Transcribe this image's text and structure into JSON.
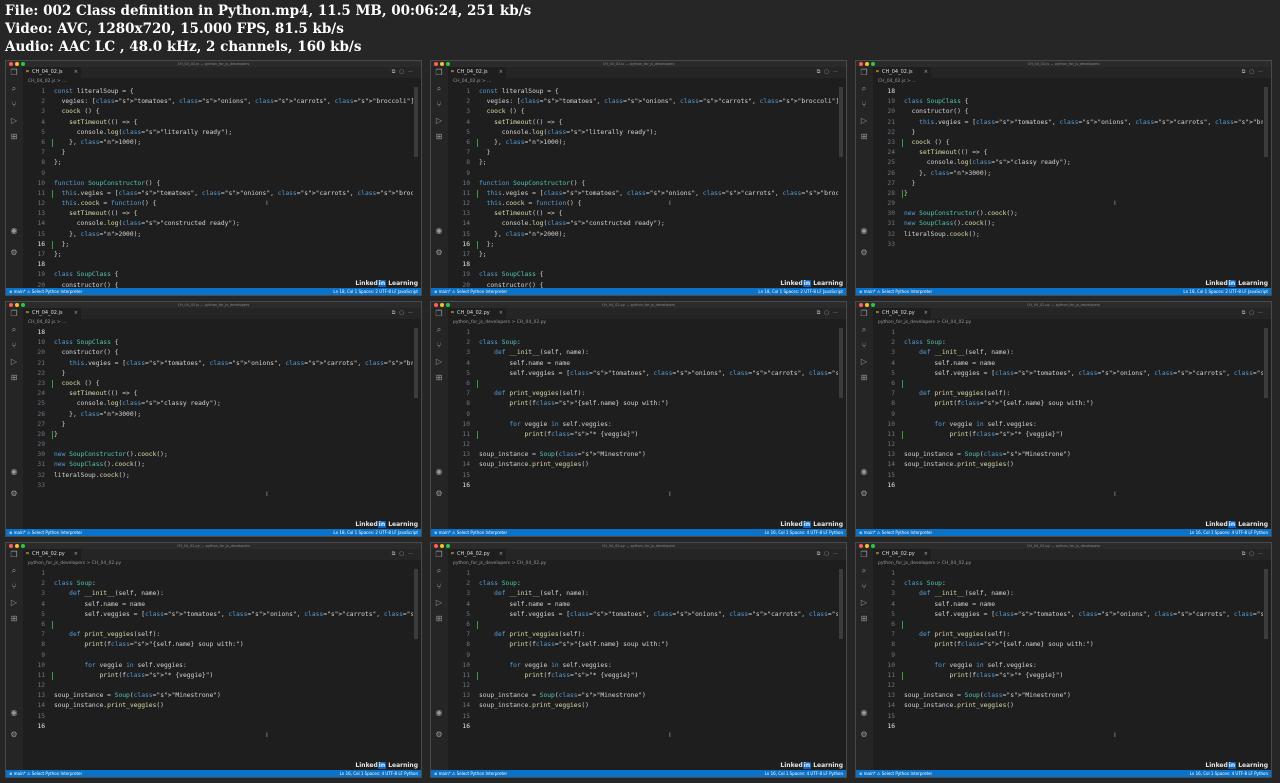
{
  "meta": {
    "line1": "File: 002 Class definition in Python.mp4, 11.5 MB, 00:06:24, 251 kb/s",
    "line2": "Video: AVC, 1280x720, 15.000 FPS, 81.5 kb/s",
    "line3": "Audio: AAC LC , 48.0 kHz, 2 channels, 160 kb/s"
  },
  "colors": {
    "statusbar": "#0b72c9",
    "editor_bg": "#1e1e1e",
    "page_bg": "#262626"
  },
  "icons": [
    "files-icon",
    "search-icon",
    "source-control-icon",
    "run-debug-icon",
    "extensions-icon",
    "account-icon",
    "settings-gear-icon"
  ],
  "frames": [
    {
      "title": "CH_04_02.js — python_for_js_developers",
      "tab": "CH_04_02.js",
      "breadcrumb": "CH_04_02.js > ...",
      "status_left": "⊗ main*   ⚠ Select Python Interpreter",
      "status_right": "Ln 18, Col 1   Spaces: 2   UTF-8   LF   JavaScript",
      "lines": [
        {
          "n": "1",
          "t": "const literalSoup = {"
        },
        {
          "n": "2",
          "t": "  vegies: [\"tomatoes\", \"onions\", \"carrots\", \"broccoli\"],"
        },
        {
          "n": "3",
          "t": "  coock () {"
        },
        {
          "n": "4",
          "t": "    setTimeout(() => {"
        },
        {
          "n": "5",
          "t": "      console.log(\"literally ready\");"
        },
        {
          "n": "6",
          "t": "    }, 1000);"
        },
        {
          "n": "7",
          "t": "  }"
        },
        {
          "n": "8",
          "t": "};"
        },
        {
          "n": "9",
          "t": ""
        },
        {
          "n": "10",
          "t": "function SoupConstructor() {"
        },
        {
          "n": "11",
          "t": "  this.vegies = [\"tomatoes\", \"onions\", \"carrots\", \"broccoli\"];"
        },
        {
          "n": "12",
          "t": "  this.coock = function() {"
        },
        {
          "n": "13",
          "t": "    setTimeout(() => {"
        },
        {
          "n": "14",
          "t": "      console.log(\"constructed ready\");"
        },
        {
          "n": "15",
          "t": "    }, 2000);"
        },
        {
          "n": "16",
          "t": "  };"
        },
        {
          "n": "17",
          "t": "};"
        },
        {
          "n": "18",
          "t": ""
        },
        {
          "n": "19",
          "t": "class SoupClass {"
        },
        {
          "n": "20",
          "t": "  constructor() {"
        }
      ]
    },
    {
      "title": "CH_04_02.js — python_for_js_developers",
      "tab": "CH_04_02.js",
      "breadcrumb": "CH_04_02.js > ...",
      "status_left": "⊗ main*   ⚠ Select Python Interpreter",
      "status_right": "Ln 18, Col 1   Spaces: 2   UTF-8   LF   JavaScript",
      "lines": [
        {
          "n": "1",
          "t": "const literalSoup = {"
        },
        {
          "n": "2",
          "t": "  vegies: [\"tomatoes\", \"onions\", \"carrots\", \"broccoli\"],"
        },
        {
          "n": "3",
          "t": "  coock () {"
        },
        {
          "n": "4",
          "t": "    setTimeout(() => {"
        },
        {
          "n": "5",
          "t": "      console.log(\"literally ready\");"
        },
        {
          "n": "6",
          "t": "    }, 1000);"
        },
        {
          "n": "7",
          "t": "  }"
        },
        {
          "n": "8",
          "t": "};"
        },
        {
          "n": "9",
          "t": ""
        },
        {
          "n": "10",
          "t": "function SoupConstructor() {"
        },
        {
          "n": "11",
          "t": "  this.vegies = [\"tomatoes\", \"onions\", \"carrots\", \"broccoli\"];"
        },
        {
          "n": "12",
          "t": "  this.coock = function() {"
        },
        {
          "n": "13",
          "t": "    setTimeout(() => {"
        },
        {
          "n": "14",
          "t": "      console.log(\"constructed ready\");"
        },
        {
          "n": "15",
          "t": "    }, 2000);"
        },
        {
          "n": "16",
          "t": "  };"
        },
        {
          "n": "17",
          "t": "};"
        },
        {
          "n": "18",
          "t": ""
        },
        {
          "n": "19",
          "t": "class SoupClass {"
        },
        {
          "n": "20",
          "t": "  constructor() {"
        }
      ]
    },
    {
      "title": "CH_04_02.js — python_for_js_developers",
      "tab": "CH_04_02.js",
      "breadcrumb": "CH_04_02.js > ...",
      "status_left": "⊗ main*   ⚠ Select Python Interpreter",
      "status_right": "Ln 18, Col 1   Spaces: 2   UTF-8   LF   JavaScript",
      "lines": [
        {
          "n": "18",
          "t": ""
        },
        {
          "n": "19",
          "t": "class SoupClass {"
        },
        {
          "n": "20",
          "t": "  constructor() {"
        },
        {
          "n": "21",
          "t": "    this.vegies = [\"tomatoes\", \"onions\", \"carrots\", \"broccoli\"];"
        },
        {
          "n": "22",
          "t": "  }"
        },
        {
          "n": "23",
          "t": "  coock () {"
        },
        {
          "n": "24",
          "t": "    setTimeout(() => {"
        },
        {
          "n": "25",
          "t": "      console.log(\"classy ready\");"
        },
        {
          "n": "26",
          "t": "    }, 3000);"
        },
        {
          "n": "27",
          "t": "  }"
        },
        {
          "n": "28",
          "t": "}"
        },
        {
          "n": "29",
          "t": ""
        },
        {
          "n": "30",
          "t": "new SoupConstructor().coock();"
        },
        {
          "n": "31",
          "t": "new SoupClass().coock();"
        },
        {
          "n": "32",
          "t": "literalSoup.coock();"
        },
        {
          "n": "33",
          "t": ""
        }
      ]
    },
    {
      "title": "CH_04_02.js — python_for_js_developers",
      "tab": "CH_04_02.js",
      "breadcrumb": "CH_04_02.js > ...",
      "status_left": "⊗ main*   ⚠ Select Python Interpreter",
      "status_right": "Ln 18, Col 1   Spaces: 2   UTF-8   LF   JavaScript",
      "lines": [
        {
          "n": "18",
          "t": ""
        },
        {
          "n": "19",
          "t": "class SoupClass {"
        },
        {
          "n": "20",
          "t": "  constructor() {"
        },
        {
          "n": "21",
          "t": "    this.vegies = [\"tomatoes\", \"onions\", \"carrots\", \"broccoli\"];"
        },
        {
          "n": "22",
          "t": "  }"
        },
        {
          "n": "23",
          "t": "  coock () {"
        },
        {
          "n": "24",
          "t": "    setTimeout(() => {"
        },
        {
          "n": "25",
          "t": "      console.log(\"classy ready\");"
        },
        {
          "n": "26",
          "t": "    }, 3000);"
        },
        {
          "n": "27",
          "t": "  }"
        },
        {
          "n": "28",
          "t": "}"
        },
        {
          "n": "29",
          "t": ""
        },
        {
          "n": "30",
          "t": "new SoupConstructor().coock();"
        },
        {
          "n": "31",
          "t": "new SoupClass().coock();"
        },
        {
          "n": "32",
          "t": "literalSoup.coock();"
        },
        {
          "n": "33",
          "t": ""
        }
      ]
    },
    {
      "title": "CH_04_02.py — python_for_js_developers",
      "tab": "CH_04_02.py",
      "breadcrumb": "python_for_js_developers > CH_04_02.py",
      "status_left": "⊗ main*   ⚠ Select Python Interpreter",
      "status_right": "Ln 16, Col 1   Spaces: 4   UTF-8   LF   Python",
      "lines": [
        {
          "n": "1",
          "t": ""
        },
        {
          "n": "2",
          "t": "class Soup:"
        },
        {
          "n": "3",
          "t": "    def __init__(self, name):"
        },
        {
          "n": "4",
          "t": "        self.name = name"
        },
        {
          "n": "5",
          "t": "        self.veggies = [\"tomatoes\", \"onions\", \"carrots\", \"broccoli\"]"
        },
        {
          "n": "6",
          "t": ""
        },
        {
          "n": "7",
          "t": "    def print_veggies(self):"
        },
        {
          "n": "8",
          "t": "        print(f\"{self.name} soup with:\")"
        },
        {
          "n": "9",
          "t": ""
        },
        {
          "n": "10",
          "t": "        for veggie in self.veggies:"
        },
        {
          "n": "11",
          "t": "            print(f\"* {veggie}\")"
        },
        {
          "n": "12",
          "t": ""
        },
        {
          "n": "13",
          "t": "soup_instance = Soup(\"Minestrone\")"
        },
        {
          "n": "14",
          "t": "soup_instance.print_veggies()"
        },
        {
          "n": "15",
          "t": ""
        },
        {
          "n": "16",
          "t": ""
        }
      ]
    },
    {
      "title": "CH_04_02.py — python_for_js_developers",
      "tab": "CH_04_02.py",
      "breadcrumb": "python_for_js_developers > CH_04_02.py",
      "status_left": "⊗ main*   ⚠ Select Python Interpreter",
      "status_right": "Ln 16, Col 1   Spaces: 4   UTF-8   LF   Python",
      "lines": [
        {
          "n": "1",
          "t": ""
        },
        {
          "n": "2",
          "t": "class Soup:"
        },
        {
          "n": "3",
          "t": "    def __init__(self, name):"
        },
        {
          "n": "4",
          "t": "        self.name = name"
        },
        {
          "n": "5",
          "t": "        self.veggies = [\"tomatoes\", \"onions\", \"carrots\", \"broccoli\"]"
        },
        {
          "n": "6",
          "t": ""
        },
        {
          "n": "7",
          "t": "    def print_veggies(self):"
        },
        {
          "n": "8",
          "t": "        print(f\"{self.name} soup with:\")"
        },
        {
          "n": "9",
          "t": ""
        },
        {
          "n": "10",
          "t": "        for veggie in self.veggies:"
        },
        {
          "n": "11",
          "t": "            print(f\"* {veggie}\")"
        },
        {
          "n": "12",
          "t": ""
        },
        {
          "n": "13",
          "t": "soup_instance = Soup(\"Minestrone\")"
        },
        {
          "n": "14",
          "t": "soup_instance.print_veggies()"
        },
        {
          "n": "15",
          "t": ""
        },
        {
          "n": "16",
          "t": ""
        }
      ]
    },
    {
      "title": "CH_04_02.py — python_for_js_developers",
      "tab": "CH_04_02.py",
      "breadcrumb": "python_for_js_developers > CH_04_02.py",
      "status_left": "⊗ main*   ⚠ Select Python Interpreter",
      "status_right": "Ln 16, Col 1   Spaces: 4   UTF-8   LF   Python",
      "lines": [
        {
          "n": "1",
          "t": ""
        },
        {
          "n": "2",
          "t": "class Soup:"
        },
        {
          "n": "3",
          "t": "    def __init__(self, name):"
        },
        {
          "n": "4",
          "t": "        self.name = name"
        },
        {
          "n": "5",
          "t": "        self.veggies = [\"tomatoes\", \"onions\", \"carrots\", \"broccoli\"]"
        },
        {
          "n": "6",
          "t": ""
        },
        {
          "n": "7",
          "t": "    def print_veggies(self):"
        },
        {
          "n": "8",
          "t": "        print(f\"{self.name} soup with:\")"
        },
        {
          "n": "9",
          "t": ""
        },
        {
          "n": "10",
          "t": "        for veggie in self.veggies:"
        },
        {
          "n": "11",
          "t": "            print(f\"* {veggie}\")"
        },
        {
          "n": "12",
          "t": ""
        },
        {
          "n": "13",
          "t": "soup_instance = Soup(\"Minestrone\")"
        },
        {
          "n": "14",
          "t": "soup_instance.print_veggies()"
        },
        {
          "n": "15",
          "t": ""
        },
        {
          "n": "16",
          "t": ""
        }
      ]
    },
    {
      "title": "CH_04_02.py — python_for_js_developers",
      "tab": "CH_04_02.py",
      "breadcrumb": "python_for_js_developers > CH_04_02.py",
      "status_left": "⊗ main*   ⚠ Select Python Interpreter",
      "status_right": "Ln 16, Col 1   Spaces: 4   UTF-8   LF   Python",
      "lines": [
        {
          "n": "1",
          "t": ""
        },
        {
          "n": "2",
          "t": "class Soup:"
        },
        {
          "n": "3",
          "t": "    def __init__(self, name):"
        },
        {
          "n": "4",
          "t": "        self.name = name"
        },
        {
          "n": "5",
          "t": "        self.veggies = [\"tomatoes\", \"onions\", \"carrots\", \"broccoli\"]"
        },
        {
          "n": "6",
          "t": ""
        },
        {
          "n": "7",
          "t": "    def print_veggies(self):"
        },
        {
          "n": "8",
          "t": "        print(f\"{self.name} soup with:\")"
        },
        {
          "n": "9",
          "t": ""
        },
        {
          "n": "10",
          "t": "        for veggie in self.veggies:"
        },
        {
          "n": "11",
          "t": "            print(f\"* {veggie}\")"
        },
        {
          "n": "12",
          "t": ""
        },
        {
          "n": "13",
          "t": "soup_instance = Soup(\"Minestrone\")"
        },
        {
          "n": "14",
          "t": "soup_instance.print_veggies()"
        },
        {
          "n": "15",
          "t": ""
        },
        {
          "n": "16",
          "t": ""
        }
      ]
    },
    {
      "title": "CH_04_02.py — python_for_js_developers",
      "tab": "CH_04_02.py",
      "breadcrumb": "python_for_js_developers > CH_04_02.py",
      "status_left": "⊗ main*   ⚠ Select Python Interpreter",
      "status_right": "Ln 16, Col 1   Spaces: 4   UTF-8   LF   Python",
      "lines": [
        {
          "n": "1",
          "t": ""
        },
        {
          "n": "2",
          "t": "class Soup:"
        },
        {
          "n": "3",
          "t": "    def __init__(self, name):"
        },
        {
          "n": "4",
          "t": "        self.name = name"
        },
        {
          "n": "5",
          "t": "        self.veggies = [\"tomatoes\", \"onions\", \"carrots\", \"broccoli\"]"
        },
        {
          "n": "6",
          "t": ""
        },
        {
          "n": "7",
          "t": "    def print_veggies(self):"
        },
        {
          "n": "8",
          "t": "        print(f\"{self.name} soup with:\")"
        },
        {
          "n": "9",
          "t": ""
        },
        {
          "n": "10",
          "t": "        for veggie in self.veggies:"
        },
        {
          "n": "11",
          "t": "            print(f\"* {veggie}\")"
        },
        {
          "n": "12",
          "t": ""
        },
        {
          "n": "13",
          "t": "soup_instance = Soup(\"Minestrone\")"
        },
        {
          "n": "14",
          "t": "soup_instance.print_veggies()"
        },
        {
          "n": "15",
          "t": ""
        },
        {
          "n": "16",
          "t": ""
        }
      ]
    }
  ]
}
